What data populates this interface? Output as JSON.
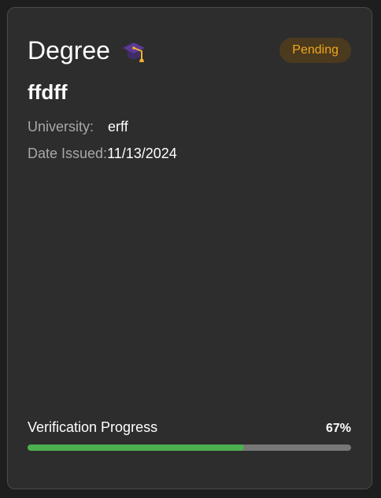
{
  "card": {
    "type_title": "Degree",
    "icon": "graduation-cap-icon",
    "status": "Pending",
    "degree_name": "ffdff",
    "university_label": "University:",
    "university_value": "erff",
    "date_label": "Date Issued:",
    "date_value": "11/13/2024",
    "progress_label": "Verification Progress",
    "progress_text": "67%",
    "progress_fraction": 0.67
  },
  "colors": {
    "background": "#1e1e1e",
    "card_background": "#2d2d2d",
    "card_border": "#4a4a4a",
    "status_background": "#4b3a1d",
    "status_text": "#f0a71e",
    "progress_fill": "#4caf50",
    "progress_track": "#777777"
  }
}
